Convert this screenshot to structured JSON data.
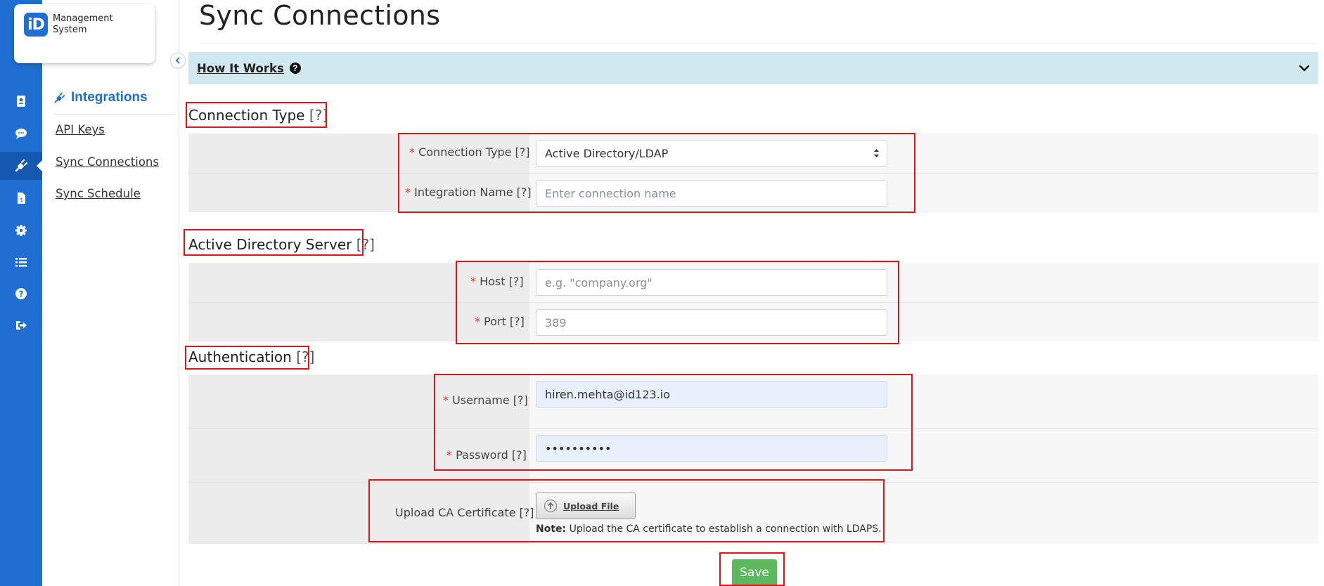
{
  "logo": {
    "mark": "iD",
    "line1": "Management",
    "line2": "System"
  },
  "rail": {
    "items": [
      {
        "icon": "contact-card-icon"
      },
      {
        "icon": "chat-icon"
      },
      {
        "icon": "plug-icon",
        "active": true
      },
      {
        "icon": "invoice-icon"
      },
      {
        "icon": "gear-icon"
      },
      {
        "icon": "list-icon"
      },
      {
        "icon": "help-icon"
      },
      {
        "icon": "sign-out-icon"
      }
    ]
  },
  "subnav": {
    "heading": "Integrations",
    "links": [
      "API Keys",
      "Sync Connections",
      "Sync Schedule"
    ]
  },
  "page": {
    "title": "Sync Connections",
    "how_it_works": "How It Works"
  },
  "sections": {
    "connection_type": {
      "title": "Connection Type",
      "help": "[?]"
    },
    "ad_server": {
      "title": "Active Directory Server",
      "help": "[?]"
    },
    "authentication": {
      "title": "Authentication",
      "help": "[?]"
    }
  },
  "fields": {
    "connection_type": {
      "required": "*",
      "label": "Connection Type [?]",
      "value": "Active Directory/LDAP"
    },
    "integration_name": {
      "required": "*",
      "label": "Integration Name [?]",
      "placeholder": "Enter connection name"
    },
    "host": {
      "required": "*",
      "label": "Host [?]",
      "placeholder": "e.g. \"company.org\""
    },
    "port": {
      "required": "*",
      "label": "Port [?]",
      "value": "389"
    },
    "username": {
      "required": "*",
      "label": "Username [?]",
      "value": "hiren.mehta@id123.io"
    },
    "password": {
      "required": "*",
      "label": "Password [?]",
      "value": "••••••••••"
    },
    "ca_cert": {
      "label": "Upload CA Certificate [?]",
      "button": "Upload File",
      "note_prefix": "Note:",
      "note_text": " Upload the CA certificate to establish a connection with LDAPS."
    }
  },
  "actions": {
    "save": "Save"
  },
  "colors": {
    "brand": "#1f6fd0",
    "highlight": "#e0131a",
    "save": "#5cb85c",
    "info_bar": "#d2e8ef"
  }
}
